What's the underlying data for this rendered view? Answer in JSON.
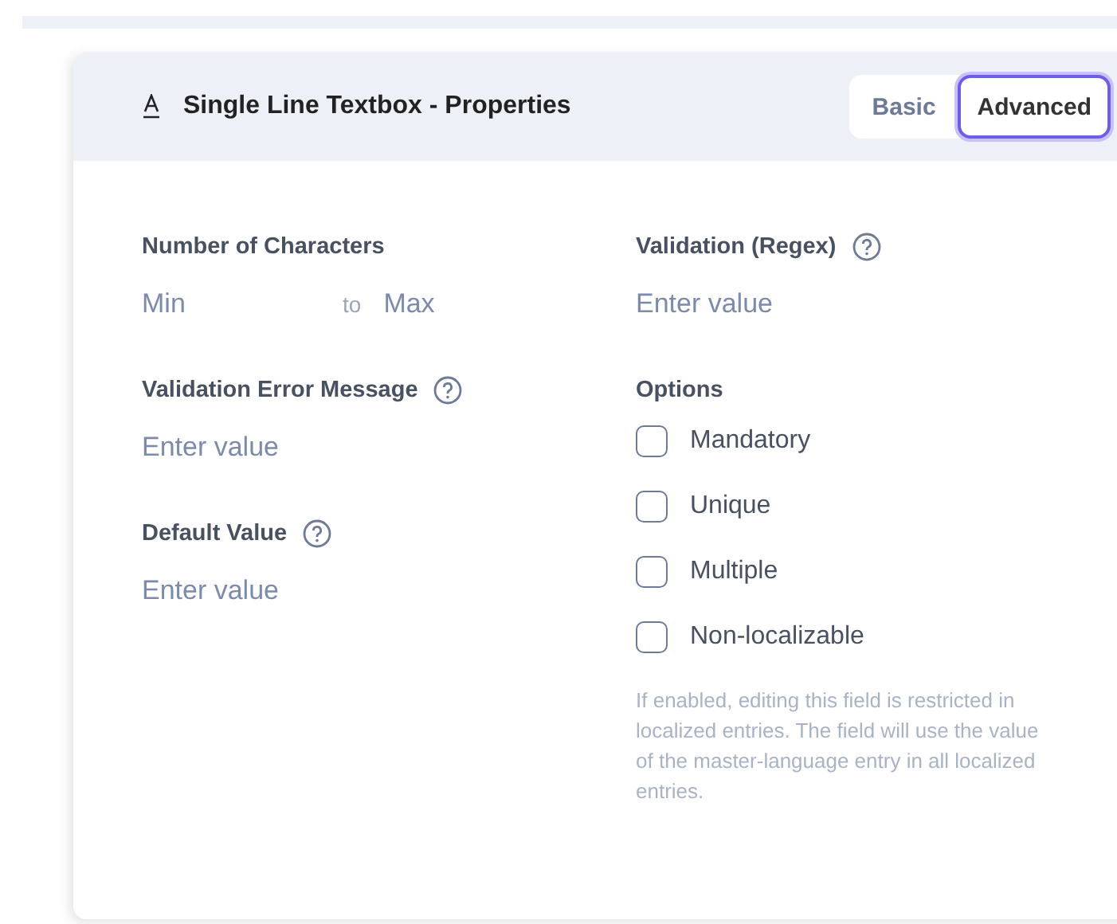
{
  "panel": {
    "title": "Single Line Textbox - Properties"
  },
  "tabs": [
    {
      "label": "Basic",
      "selected": false
    },
    {
      "label": "Advanced",
      "selected": true
    }
  ],
  "characters": {
    "label": "Number of Characters",
    "min_placeholder": "Min",
    "separator": "to",
    "max_placeholder": "Max"
  },
  "regex": {
    "label": "Validation (Regex)",
    "placeholder": "Enter value"
  },
  "error_message": {
    "label": "Validation Error Message",
    "placeholder": "Enter value"
  },
  "default_value": {
    "label": "Default Value",
    "placeholder": "Enter value"
  },
  "options": {
    "label": "Options",
    "items": [
      {
        "label": "Mandatory",
        "checked": false
      },
      {
        "label": "Unique",
        "checked": false
      },
      {
        "label": "Multiple",
        "checked": false
      },
      {
        "label": "Non-localizable",
        "checked": false
      }
    ],
    "hint": "If enabled, editing this field is restricted in localized entries. The field will use the value of the master-language entry in all localized entries."
  }
}
